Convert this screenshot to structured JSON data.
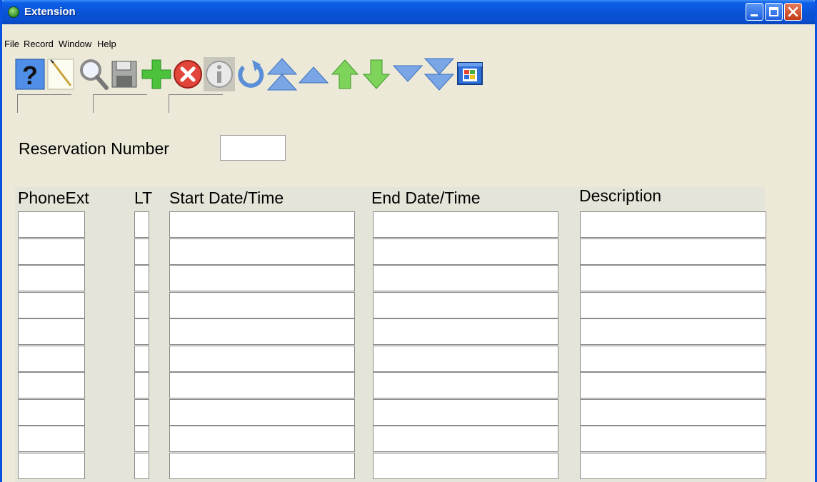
{
  "window": {
    "title": "Extension",
    "minimize_icon": "minimize-icon",
    "maximize_icon": "maximize-icon",
    "close_icon": "close-icon"
  },
  "menu": [
    {
      "label": "File"
    },
    {
      "label": "Record"
    },
    {
      "label": "Window"
    },
    {
      "label": "Help"
    }
  ],
  "toolbar": [
    {
      "name": "help-button",
      "icon": "help-icon"
    },
    {
      "name": "new-button",
      "icon": "new-document-icon"
    },
    {
      "name": "search-button",
      "icon": "search-icon"
    },
    {
      "name": "save-button",
      "icon": "save-icon"
    },
    {
      "name": "add-button",
      "icon": "plus-icon"
    },
    {
      "name": "delete-button",
      "icon": "delete-icon"
    },
    {
      "name": "info-button",
      "icon": "info-icon"
    },
    {
      "name": "refresh-button",
      "icon": "refresh-icon"
    },
    {
      "name": "first-record-button",
      "icon": "double-up-icon"
    },
    {
      "name": "previous-page-button",
      "icon": "triangle-up-icon"
    },
    {
      "name": "previous-record-button",
      "icon": "arrow-up-icon"
    },
    {
      "name": "next-record-button",
      "icon": "arrow-down-icon"
    },
    {
      "name": "next-page-button",
      "icon": "triangle-down-icon"
    },
    {
      "name": "last-record-button",
      "icon": "double-down-icon"
    },
    {
      "name": "windows-button",
      "icon": "windows-icon"
    }
  ],
  "form": {
    "reservation_label": "Reservation Number",
    "reservation_value": ""
  },
  "columns": {
    "phone_ext": "PhoneExt",
    "lt": "LT",
    "start": "Start Date/Time",
    "end": "End Date/Time",
    "description": "Description"
  },
  "rows": [
    {
      "phone_ext": "",
      "lt": "",
      "start": "",
      "end": "",
      "description": ""
    },
    {
      "phone_ext": "",
      "lt": "",
      "start": "",
      "end": "",
      "description": ""
    },
    {
      "phone_ext": "",
      "lt": "",
      "start": "",
      "end": "",
      "description": ""
    },
    {
      "phone_ext": "",
      "lt": "",
      "start": "",
      "end": "",
      "description": ""
    },
    {
      "phone_ext": "",
      "lt": "",
      "start": "",
      "end": "",
      "description": ""
    },
    {
      "phone_ext": "",
      "lt": "",
      "start": "",
      "end": "",
      "description": ""
    },
    {
      "phone_ext": "",
      "lt": "",
      "start": "",
      "end": "",
      "description": ""
    },
    {
      "phone_ext": "",
      "lt": "",
      "start": "",
      "end": "",
      "description": ""
    },
    {
      "phone_ext": "",
      "lt": "",
      "start": "",
      "end": "",
      "description": ""
    },
    {
      "phone_ext": "",
      "lt": "",
      "start": "",
      "end": "",
      "description": ""
    }
  ],
  "colors": {
    "titlebar": "#0853d6",
    "window_bg": "#ece9d8",
    "close_button": "#c23a15"
  }
}
